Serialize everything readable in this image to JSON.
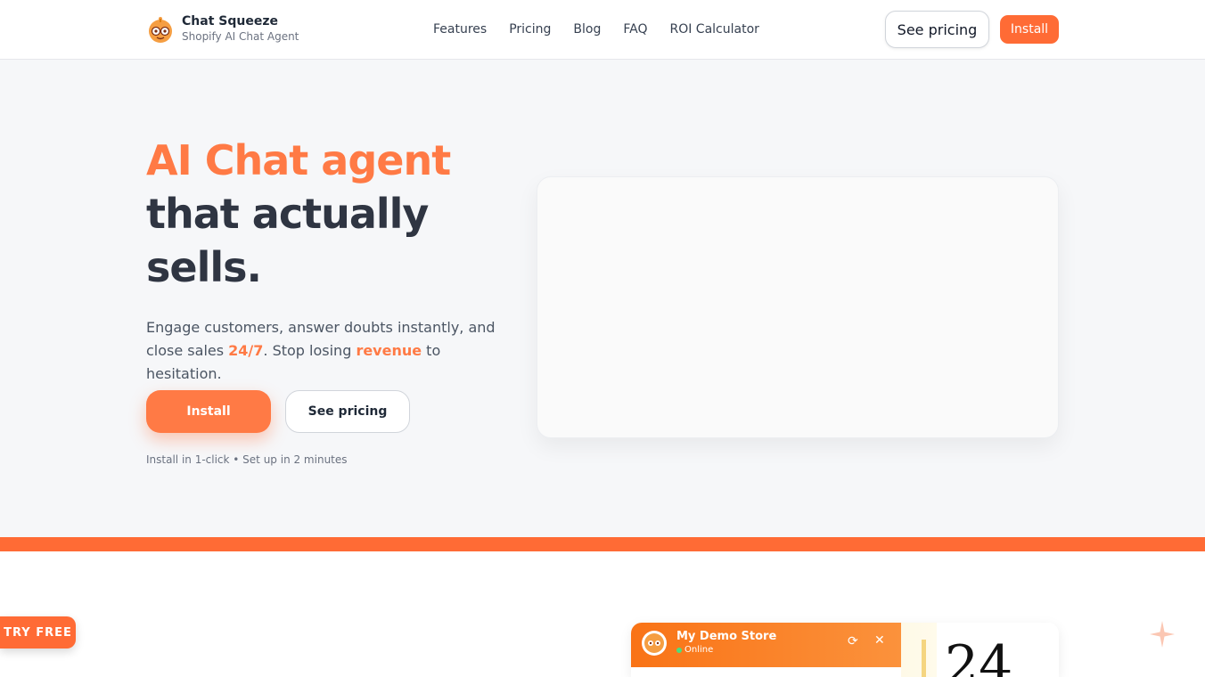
{
  "header": {
    "brand_name": "Chat Squeeze",
    "brand_sub": "Shopify AI Chat Agent",
    "nav": [
      "Features",
      "Pricing",
      "Blog",
      "FAQ",
      "ROI Calculator"
    ],
    "see_pricing": "See pricing",
    "install": "Install"
  },
  "hero": {
    "title_accent": "AI Chat agent",
    "title_line2": "that actually",
    "title_line3": "sells.",
    "desc_part1": "Engage customers, answer doubts instantly, and close sales ",
    "desc_hl1": "24/7",
    "desc_part2": ". Stop losing ",
    "desc_hl2": "revenue",
    "desc_part3": " to hesitation.",
    "install": "Install",
    "see_pricing": "See pricing",
    "note": "Install in 1-click • Set up in 2 minutes"
  },
  "floating": {
    "try_free": "TRY FREE"
  },
  "demo": {
    "store_name": "My Demo Store",
    "status": "Online",
    "refresh_glyph": "⟳",
    "close_glyph": "✕",
    "big_number": "24"
  },
  "colors": {
    "accent": "#ff6b35",
    "accent_light": "#ff7a45",
    "dark_text": "#2f3542"
  },
  "icons": {
    "logo": "robot-mascot-icon",
    "sparkle": "sparkle-icon",
    "refresh": "refresh-icon",
    "close": "close-icon"
  }
}
